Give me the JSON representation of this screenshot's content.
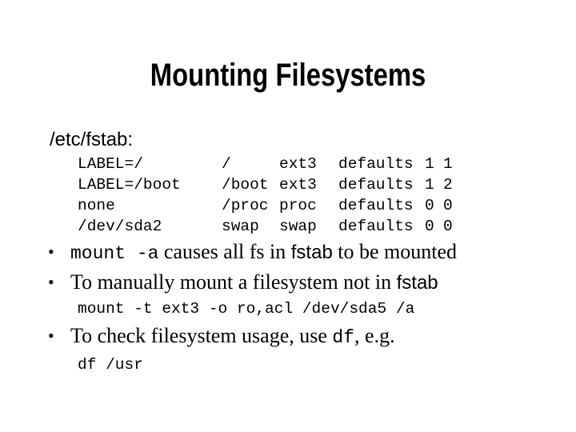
{
  "title": "Mounting Filesystems",
  "subtitle": "/etc/fstab:",
  "fstab": [
    [
      "LABEL=/",
      "/",
      "ext3",
      "defaults",
      "1",
      "1"
    ],
    [
      "LABEL=/boot",
      "/boot",
      "ext3",
      "defaults",
      "1",
      "2"
    ],
    [
      "none",
      "/proc",
      "proc",
      "defaults",
      "0",
      "0"
    ],
    [
      "/dev/sda2",
      "swap",
      "swap",
      "defaults",
      "0",
      "0"
    ]
  ],
  "bullets": [
    {
      "code": "mount -a",
      "text1": " causes all fs in ",
      "sans": "fstab",
      "text2": " to be mounted"
    },
    {
      "text1": "To manually mount a filesystem not in ",
      "sans": "fstab",
      "example": "mount -t ext3 -o ro,acl /dev/sda5 /a"
    },
    {
      "text1": "To check filesystem usage, use ",
      "code": "df",
      "text2": ", e.g.",
      "example": "df /usr"
    }
  ]
}
